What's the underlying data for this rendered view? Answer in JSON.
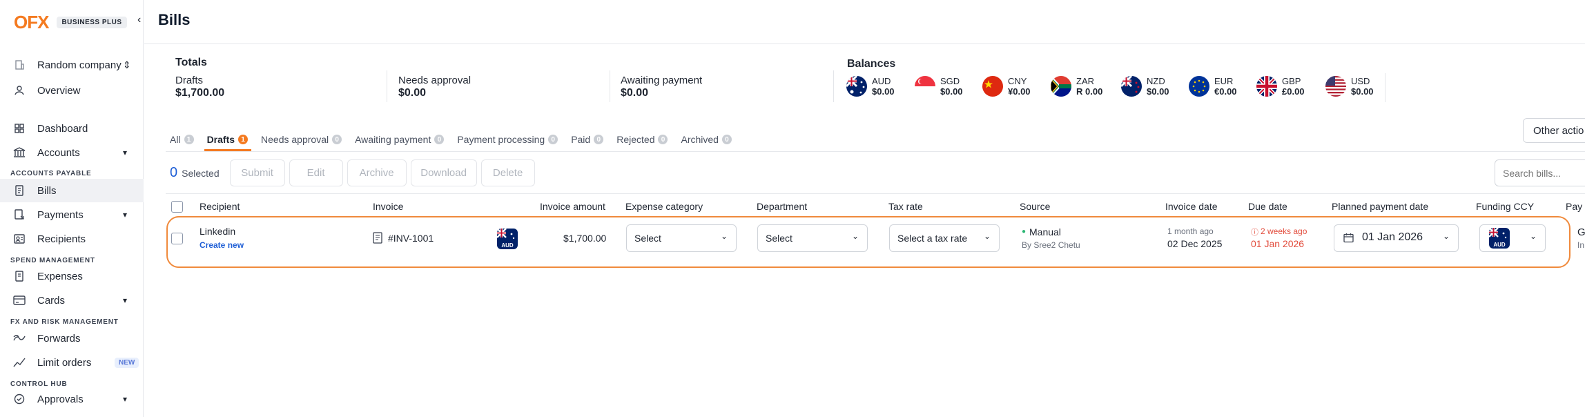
{
  "brand": {
    "logo": "OFX",
    "badge": "BUSINESS PLUS"
  },
  "sidebar": {
    "company": "Random company",
    "overview": "Overview",
    "dashboard": "Dashboard",
    "accounts": "Accounts",
    "section_ap": "ACCOUNTS PAYABLE",
    "bills": "Bills",
    "payments": "Payments",
    "recipients": "Recipients",
    "section_spend": "SPEND MANAGEMENT",
    "expenses": "Expenses",
    "cards": "Cards",
    "section_fx": "FX AND RISK MANAGEMENT",
    "forwards": "Forwards",
    "limit_orders": "Limit orders",
    "new_badge": "NEW",
    "section_control": "CONTROL HUB",
    "approvals": "Approvals"
  },
  "header": {
    "title": "Bills"
  },
  "totals": {
    "title": "Totals",
    "drafts_label": "Drafts",
    "drafts_value": "$1,700.00",
    "needs_label": "Needs approval",
    "needs_value": "$0.00",
    "awaiting_label": "Awaiting payment",
    "awaiting_value": "$0.00"
  },
  "balances": {
    "title": "Balances",
    "items": [
      {
        "code": "AUD",
        "value": "$0.00"
      },
      {
        "code": "SGD",
        "value": "$0.00"
      },
      {
        "code": "CNY",
        "value": "¥0.00"
      },
      {
        "code": "ZAR",
        "value": "R 0.00"
      },
      {
        "code": "NZD",
        "value": "$0.00"
      },
      {
        "code": "EUR",
        "value": "€0.00"
      },
      {
        "code": "GBP",
        "value": "£0.00"
      },
      {
        "code": "USD",
        "value": "$0.00"
      }
    ]
  },
  "tabs": [
    {
      "label": "All",
      "count": "1"
    },
    {
      "label": "Drafts",
      "count": "1"
    },
    {
      "label": "Needs approval",
      "count": "0"
    },
    {
      "label": "Awaiting payment",
      "count": "0"
    },
    {
      "label": "Payment processing",
      "count": "0"
    },
    {
      "label": "Paid",
      "count": "0"
    },
    {
      "label": "Rejected",
      "count": "0"
    },
    {
      "label": "Archived",
      "count": "0"
    }
  ],
  "other_actions": "Other actio",
  "toolbar": {
    "selected_count": "0",
    "selected_label": "Selected",
    "submit": "Submit",
    "edit": "Edit",
    "archive": "Archive",
    "download": "Download",
    "delete": "Delete"
  },
  "search": {
    "placeholder": "Search bills..."
  },
  "columns": {
    "recipient": "Recipient",
    "invoice": "Invoice",
    "invoice_amount": "Invoice amount",
    "expense_category": "Expense category",
    "department": "Department",
    "tax_rate": "Tax rate",
    "source": "Source",
    "invoice_date": "Invoice date",
    "due_date": "Due date",
    "planned_payment_date": "Planned payment date",
    "funding_ccy": "Funding CCY",
    "pay": "Pay"
  },
  "row": {
    "recipient": "Linkedin",
    "create_new": "Create new",
    "invoice": "#INV-1001",
    "currency_badge": "AUD",
    "amount": "$1,700.00",
    "expense_category": "Select",
    "department": "Select",
    "tax_rate": "Select a tax rate",
    "source": "Manual",
    "source_by": "By Sree2 Chetu",
    "invoice_date_rel": "1 month ago",
    "invoice_date": "02 Dec 2025",
    "due_date_rel": "2 weeks ago",
    "due_date": "01 Jan 2026",
    "planned_date": "01 Jan 2026",
    "funding_ccy": "AUD",
    "pay_top": "G",
    "pay_bottom": "In"
  },
  "colors": {
    "accent": "#f47a20",
    "link": "#1f5fd6",
    "danger": "#e24b3b"
  }
}
